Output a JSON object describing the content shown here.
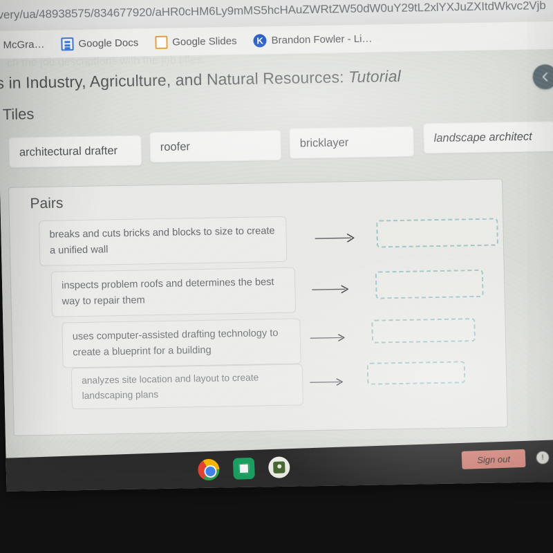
{
  "browser": {
    "url": "very/ua/48938575/834677920/aHR0cHM6Ly9mMS5hcHAuZWRtZW50dW0uY29tL2xlYXJuZXItdWkvc2Vjb",
    "bookmarks": [
      {
        "label": "McGra…",
        "icon": ""
      },
      {
        "label": "Google Docs",
        "icon": "google-docs-icon"
      },
      {
        "label": "Google Slides",
        "icon": "google-slides-icon"
      },
      {
        "label": "Brandon Fowler - Li…",
        "icon": "kami-icon"
      }
    ]
  },
  "activity": {
    "faint_prompt": "ch the job descriptions with the job titles.",
    "title_prefix": "rs in Industry, Agriculture, and Natural Resources: ",
    "title_suffix": "Tutorial",
    "nav_prev_icon": "chevron-left-icon",
    "tiles_heading": "Tiles",
    "tiles": [
      "architectural drafter",
      "roofer",
      "bricklayer",
      "landscape architect"
    ],
    "pairs_heading": "Pairs",
    "pairs": [
      {
        "description": "breaks and cuts bricks and blocks to size to create a unified wall",
        "arrow": "arrow-right-icon",
        "answer": ""
      },
      {
        "description": "inspects problem roofs and determines the best way to repair them",
        "arrow": "arrow-right-icon",
        "answer": ""
      },
      {
        "description": "uses computer-assisted drafting technology to create a blueprint for a building",
        "arrow": "arrow-right-icon",
        "answer": ""
      },
      {
        "description": "analyzes site location and layout to create landscaping plans",
        "arrow": "arrow-right-icon",
        "answer": ""
      }
    ]
  },
  "shelf": {
    "apps": [
      {
        "name": "chrome-app-icon"
      },
      {
        "name": "sheets-app-icon"
      },
      {
        "name": "contacts-app-icon"
      }
    ],
    "sign_out_label": "Sign out",
    "status_label": "!"
  },
  "colors": {
    "dropzone_border": "#9dc3c8",
    "page_background": "#d9dbd6",
    "tile_background": "#f0f1ef",
    "shelf_background": "#2b2b2b",
    "signout_background": "#d78a80"
  }
}
